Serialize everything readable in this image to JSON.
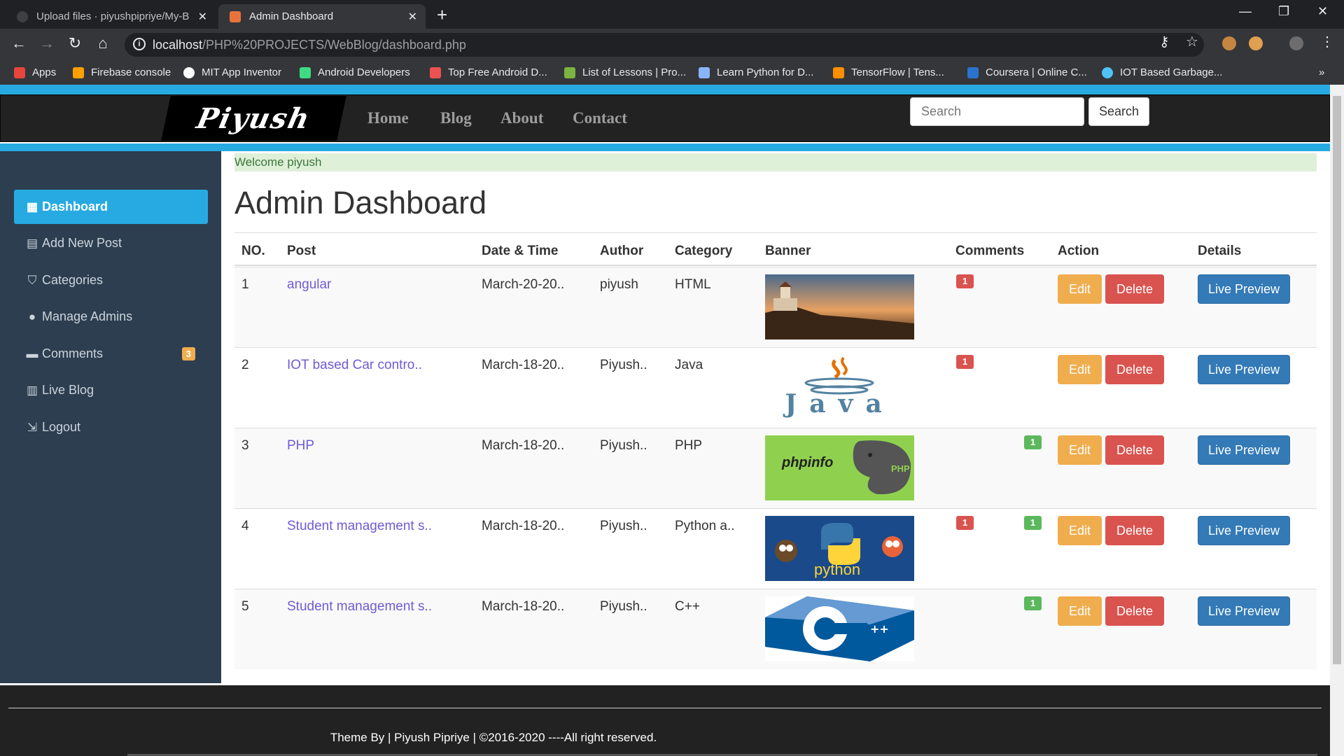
{
  "browser": {
    "tabs": [
      {
        "title": "Upload files · piyushpipriye/My-B",
        "active": false
      },
      {
        "title": "Admin Dashboard",
        "active": true
      }
    ],
    "url_host": "localhost",
    "url_path": "/PHP%20PROJECTS/WebBlog/dashboard.php",
    "bookmarks": [
      {
        "label": "Apps",
        "icon": "apps-grid-icon",
        "color": "#e8453c"
      },
      {
        "label": "Firebase console",
        "icon": "firebase-icon",
        "color": "#ffa000"
      },
      {
        "label": "MIT App Inventor",
        "icon": "google-icon",
        "color": "#ffffff"
      },
      {
        "label": "Android Developers",
        "icon": "android-icon",
        "color": "#3ddc84"
      },
      {
        "label": "Top Free Android D...",
        "icon": "udemy-icon",
        "color": "#ec5252"
      },
      {
        "label": "List of Lessons | Pro...",
        "icon": "lessons-icon",
        "color": "#7cb342"
      },
      {
        "label": "Learn Python for D...",
        "icon": "shield-icon",
        "color": "#8ab4f8"
      },
      {
        "label": "TensorFlow | Tens...",
        "icon": "tensorflow-icon",
        "color": "#ff8f00"
      },
      {
        "label": "Coursera | Online C...",
        "icon": "coursera-icon",
        "color": "#2a73cc"
      },
      {
        "label": "IOT Based Garbage...",
        "icon": "globe-icon",
        "color": "#4fc3f7"
      }
    ]
  },
  "nav": {
    "logo": "Piyush",
    "links": [
      "Home",
      "Blog",
      "About",
      "Contact"
    ],
    "search_placeholder": "Search",
    "search_button": "Search"
  },
  "sidebar": {
    "items": [
      {
        "label": "Dashboard",
        "icon": "grid-icon",
        "active": true
      },
      {
        "label": "Add New Post",
        "icon": "list-icon",
        "active": false
      },
      {
        "label": "Categories",
        "icon": "tags-icon",
        "active": false
      },
      {
        "label": "Manage Admins",
        "icon": "user-icon",
        "active": false
      },
      {
        "label": "Comments",
        "icon": "comment-icon",
        "active": false,
        "badge": "3"
      },
      {
        "label": "Live Blog",
        "icon": "chart-icon",
        "active": false
      },
      {
        "label": "Logout",
        "icon": "logout-icon",
        "active": false
      }
    ]
  },
  "main": {
    "welcome": "Welcome piyush",
    "title": "Admin Dashboard",
    "columns": [
      "NO.",
      "Post",
      "Date & Time",
      "Author",
      "Category",
      "Banner",
      "Comments",
      "Action",
      "Details"
    ],
    "edit_label": "Edit",
    "delete_label": "Delete",
    "preview_label": "Live Preview",
    "rows": [
      {
        "no": "1",
        "post": "angular",
        "date": "March-20-20..",
        "author": "piyush",
        "category": "HTML",
        "banner": "lighthouse-sunset-banner",
        "unapproved": "1",
        "approved": ""
      },
      {
        "no": "2",
        "post": "IOT based Car contro..",
        "date": "March-18-20..",
        "author": "Piyush..",
        "category": "Java",
        "banner": "java-logo-banner",
        "unapproved": "1",
        "approved": ""
      },
      {
        "no": "3",
        "post": "PHP",
        "date": "March-18-20..",
        "author": "Piyush..",
        "category": "PHP",
        "banner": "phpinfo-banner",
        "unapproved": "",
        "approved": "1"
      },
      {
        "no": "4",
        "post": "Student management s..",
        "date": "March-18-20..",
        "author": "Piyush..",
        "category": "Python a..",
        "banner": "python-banner",
        "unapproved": "1",
        "approved": "1"
      },
      {
        "no": "5",
        "post": "Student management s..",
        "date": "March-18-20..",
        "author": "Piyush..",
        "category": "C++",
        "banner": "cpp-logo-banner",
        "unapproved": "",
        "approved": "1"
      }
    ]
  },
  "banner_text": {
    "java": "Java",
    "phpinfo": "phpinfo",
    "php": "PHP",
    "python": "python"
  },
  "footer": {
    "text": "Theme By | Piyush Pipriye | ©2016-2020 ----All right reserved."
  },
  "colors": {
    "accent": "#27aae1",
    "sidebar": "#2c3e50",
    "navbar": "#222222",
    "link": "#6f5bd6"
  }
}
